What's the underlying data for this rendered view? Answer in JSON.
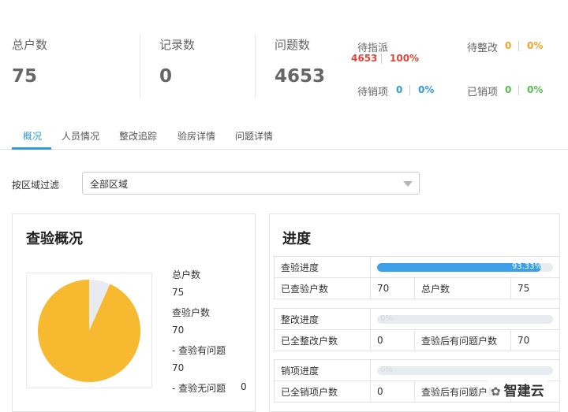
{
  "stats": {
    "households": {
      "label": "总户数",
      "value": "75"
    },
    "records": {
      "label": "记录数",
      "value": "0"
    },
    "issues": {
      "label": "问题数",
      "value": "4653"
    }
  },
  "status": {
    "pending_assign": {
      "label": "待指派",
      "count": "4653",
      "percent": "100%"
    },
    "pending_rectify": {
      "label": "待整改",
      "count": "0",
      "percent": "0%"
    },
    "pending_close": {
      "label": "待销项",
      "count": "0",
      "percent": "0%"
    },
    "closed": {
      "label": "已销项",
      "count": "0",
      "percent": "0%"
    }
  },
  "tabs": [
    "概况",
    "人员情况",
    "整改追踪",
    "验房详情",
    "问题详情"
  ],
  "active_tab": 0,
  "filter": {
    "label": "按区域过滤",
    "value": "全部区域"
  },
  "overview": {
    "title": "查验概况",
    "legend": [
      {
        "label": "总户数",
        "value": "75"
      },
      {
        "label": "查验户数",
        "value": "70"
      },
      {
        "label": "- 查验有问题",
        "value": "70"
      },
      {
        "label": "- 查验无问题",
        "value": "0"
      }
    ],
    "pie": {
      "with_issue": 70,
      "total": 75,
      "color_issue": "#f7b92f",
      "color_rest": "#e8ebf0"
    }
  },
  "progress": {
    "title": "进度",
    "sections": [
      {
        "name": "查验进度",
        "percent_text": "93.33%",
        "fraction": 0.9333,
        "row": {
          "label1": "已查验户数",
          "val1": "70",
          "label2": "总户数",
          "val2": "75"
        }
      },
      {
        "name": "整改进度",
        "percent_text": "0%",
        "fraction": 0,
        "row": {
          "label1": "已全整改户数",
          "val1": "0",
          "label2": "查验后有问题户数",
          "val2": "70"
        }
      },
      {
        "name": "销项进度",
        "percent_text": "0%",
        "fraction": 0,
        "row": {
          "label1": "已全销项户数",
          "val1": "0",
          "label2": "查验后有问题户数",
          "val2": ""
        }
      }
    ]
  },
  "watermark": {
    "icon": "wechat-icon",
    "text": "智建云"
  }
}
